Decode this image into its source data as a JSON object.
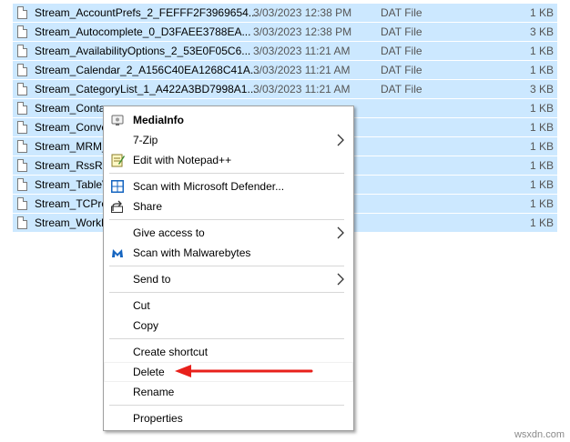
{
  "files": [
    {
      "name": "Stream_AccountPrefs_2_FEFFF2F3969654...",
      "date": "3/03/2023 12:38 PM",
      "type": "DAT File",
      "size": "1 KB"
    },
    {
      "name": "Stream_Autocomplete_0_D3FAEE3788EA...",
      "date": "3/03/2023 12:38 PM",
      "type": "DAT File",
      "size": "3 KB"
    },
    {
      "name": "Stream_AvailabilityOptions_2_53E0F05C6...",
      "date": "3/03/2023 11:21 AM",
      "type": "DAT File",
      "size": "1 KB"
    },
    {
      "name": "Stream_Calendar_2_A156C40EA1268C41A...",
      "date": "3/03/2023 11:21 AM",
      "type": "DAT File",
      "size": "1 KB"
    },
    {
      "name": "Stream_CategoryList_1_A422A3BD7998A1...",
      "date": "3/03/2023 11:21 AM",
      "type": "DAT File",
      "size": "3 KB"
    },
    {
      "name": "Stream_Conta",
      "date": "",
      "type": "",
      "size": "1 KB"
    },
    {
      "name": "Stream_Conve",
      "date": "",
      "type": "",
      "size": "1 KB"
    },
    {
      "name": "Stream_MRM_",
      "date": "",
      "type": "",
      "size": "1 KB"
    },
    {
      "name": "Stream_RssRu",
      "date": "",
      "type": "",
      "size": "1 KB"
    },
    {
      "name": "Stream_TableV",
      "date": "",
      "type": "",
      "size": "1 KB"
    },
    {
      "name": "Stream_TCPre",
      "date": "",
      "type": "",
      "size": "1 KB"
    },
    {
      "name": "Stream_Workh",
      "date": "",
      "type": "",
      "size": "1 KB"
    }
  ],
  "menu": {
    "mediainfo": "MediaInfo",
    "sevenzip": "7-Zip",
    "notepadpp": "Edit with Notepad++",
    "defender": "Scan with Microsoft Defender...",
    "share": "Share",
    "give_access": "Give access to",
    "malwarebytes": "Scan with Malwarebytes",
    "send_to": "Send to",
    "cut": "Cut",
    "copy": "Copy",
    "create_shortcut": "Create shortcut",
    "delete": "Delete",
    "rename": "Rename",
    "properties": "Properties"
  },
  "watermark": "wsxdn.com",
  "colors": {
    "selection": "#cce8ff",
    "annotation_arrow": "#e8201b",
    "defender_blue": "#1565c0",
    "malwarebytes_blue": "#1565c0"
  }
}
